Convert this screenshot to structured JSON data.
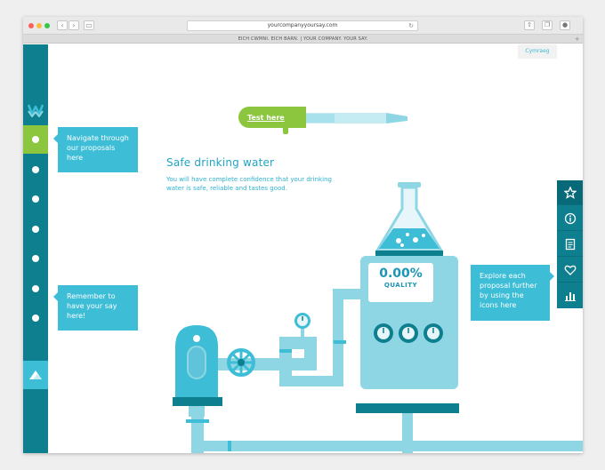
{
  "browser": {
    "url": "yourcompanyyoursay.com",
    "tab_title": "EICH CWMNI. EICH BARN. | YOUR COMPANY. YOUR SAY."
  },
  "page": {
    "language_toggle": "Cymraeg",
    "test_button": "Test here",
    "headline": "Safe drinking water",
    "description": "You will have complete confidence that your drinking water is safe, reliable and tastes good.",
    "callouts": {
      "navigate": "Navigate through our proposals here",
      "remember": "Remember to have your say here!",
      "explore": "Explore each proposal further by using the icons here"
    },
    "machine": {
      "quality_value": "0.00%",
      "quality_label": "QUALITY"
    }
  },
  "sidebar": {
    "active_index": 0,
    "proposal_count": 7
  },
  "right_panel": {
    "icons": [
      "star-icon",
      "info-icon",
      "document-icon",
      "heart-icon",
      "bar-chart-icon"
    ]
  },
  "colors": {
    "sidebar_teal": "#0e7f8f",
    "accent_green": "#8cc63f",
    "accent_cyan": "#3dbdd6",
    "pipe_light": "#8fd6e4",
    "pipe_mid": "#5fc4da"
  }
}
